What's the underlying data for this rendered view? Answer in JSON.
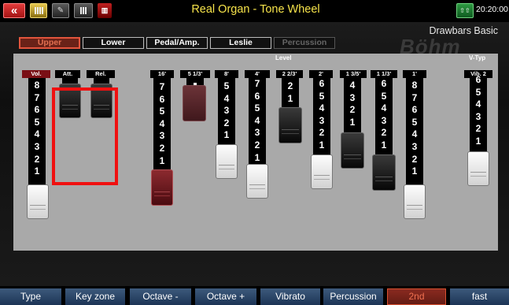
{
  "header": {
    "title": "Real Organ - Tone Wheel",
    "clock": "20:20:00",
    "buttons": [
      {
        "name": "back",
        "icon": "double-chevron-left-icon"
      },
      {
        "name": "menu",
        "icon": "drawbar-menu-icon"
      },
      {
        "name": "edit",
        "icon": "edit-pencil-icon"
      },
      {
        "name": "voice-select",
        "icon": "voice-select-icon"
      },
      {
        "name": "delete",
        "icon": "trash-icon"
      },
      {
        "name": "shift",
        "icon": "shift-keys-icon"
      }
    ]
  },
  "preset_name": "Drawbars Basic",
  "watermark": "Böhm",
  "tabs": [
    {
      "label": "Upper",
      "state": "active"
    },
    {
      "label": "Lower",
      "state": "normal"
    },
    {
      "label": "Pedal/Amp.",
      "state": "normal"
    },
    {
      "label": "Leslie",
      "state": "normal"
    },
    {
      "label": "Percussion",
      "state": "disabled"
    }
  ],
  "section_labels": {
    "level": "Level",
    "vtype": "V-Typ"
  },
  "envelope_labels": {
    "attack": "Att.",
    "release": "Rel."
  },
  "volume": {
    "label": "Vol.",
    "numbers": [
      "8",
      "7",
      "6",
      "5",
      "4",
      "3",
      "2",
      "1"
    ],
    "cap": "white"
  },
  "drawbars": [
    {
      "label": "16'",
      "numbers": [
        "7",
        "6",
        "5",
        "4",
        "3",
        "2",
        "1"
      ],
      "cap": "red"
    },
    {
      "label": "5 1/3'",
      "numbers": [],
      "cap": "ghost"
    },
    {
      "label": "8'",
      "numbers": [
        "5",
        "4",
        "3",
        "2",
        "1"
      ],
      "cap": "white"
    },
    {
      "label": "4'",
      "numbers": [
        "7",
        "6",
        "5",
        "4",
        "3",
        "2",
        "1"
      ],
      "cap": "white"
    },
    {
      "label": "2 2/3'",
      "numbers": [
        "2",
        "1"
      ],
      "cap": "black"
    },
    {
      "label": "2'",
      "numbers": [
        "6",
        "5",
        "4",
        "3",
        "2",
        "1"
      ],
      "cap": "white"
    },
    {
      "label": "1 3/5'",
      "numbers": [
        "4",
        "3",
        "2",
        "1"
      ],
      "cap": "black"
    },
    {
      "label": "1 1/3'",
      "numbers": [
        "6",
        "5",
        "4",
        "3",
        "2",
        "1"
      ],
      "cap": "black"
    },
    {
      "label": "1'",
      "numbers": [
        "8",
        "7",
        "6",
        "5",
        "4",
        "3",
        "2",
        "1"
      ],
      "cap": "white"
    }
  ],
  "vibrato": {
    "label": "Vib. 2",
    "numbers": [
      "6",
      "5",
      "4",
      "3",
      "2",
      "1"
    ],
    "cap": "white"
  },
  "bottom_buttons": [
    {
      "label": "Type",
      "active": false
    },
    {
      "label": "Key zone",
      "active": false
    },
    {
      "label": "Octave -",
      "active": false
    },
    {
      "label": "Octave +",
      "active": false
    },
    {
      "label": "Vibrato",
      "active": false
    },
    {
      "label": "Percussion",
      "active": false
    },
    {
      "label": "2nd",
      "active": true
    },
    {
      "label": "fast",
      "active": false
    }
  ],
  "colors": {
    "title": "#f6e34a",
    "active_tab": "#e2543c",
    "highlight": "#f01010",
    "button_blue": "#2e4a6c"
  }
}
